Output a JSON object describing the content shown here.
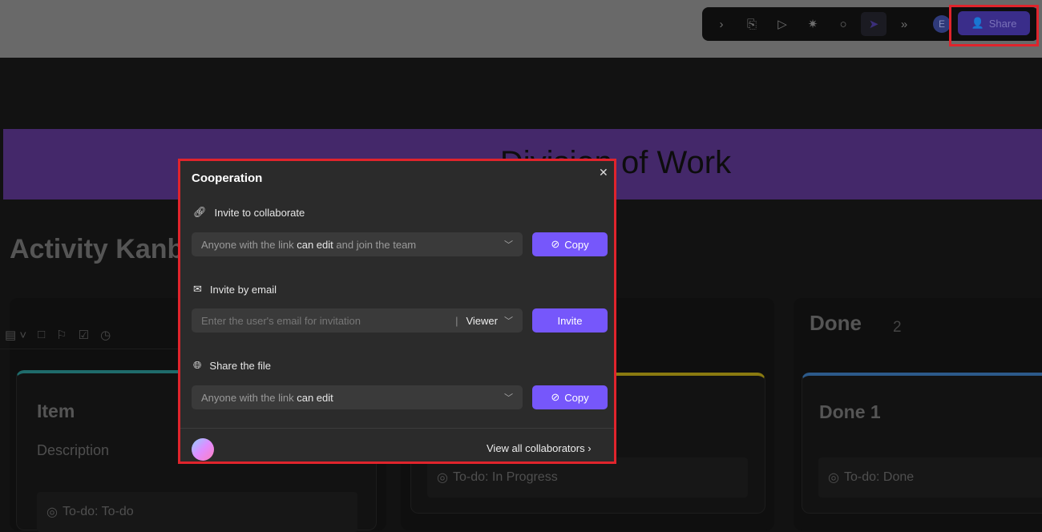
{
  "toolbar": {
    "icons": [
      "chevron-right-icon",
      "lock-file-icon",
      "play-icon",
      "party-popper-icon",
      "comment-icon",
      "cursor-icon",
      "double-chevron-down-icon"
    ],
    "user_initial": "E",
    "share_label": "Share"
  },
  "board": {
    "banner_title": "Division of Work",
    "kanban_title": "Activity Kanban",
    "columns": [
      {
        "card_title": "Item",
        "card_description": "Description",
        "todo": "To-do: To-do",
        "accent": "#1f6b6b"
      },
      {
        "todo": "To-do: In Progress",
        "accent": "#8a7a10"
      },
      {
        "header": "Done",
        "count": "2",
        "card_title": "Done 1",
        "todo": "To-do: Done",
        "accent": "#2c5a8a"
      }
    ]
  },
  "popup": {
    "title": "Cooperation",
    "invite_collab": {
      "label": "Invite to collaborate",
      "link_prefix": "Anyone with the link ",
      "link_perm": "can edit",
      "link_suffix": " and join the team",
      "copy": "Copy"
    },
    "invite_email": {
      "label": "Invite by email",
      "placeholder": "Enter the user's email for invitation",
      "role": "Viewer",
      "invite": "Invite"
    },
    "share_file": {
      "label": "Share the file",
      "link_prefix": "Anyone with the link ",
      "link_perm": "can edit",
      "copy": "Copy"
    },
    "view_all": "View all collaborators"
  },
  "colors": {
    "accent": "#7657fb",
    "highlight": "#e0242c",
    "banner": "#44286a"
  }
}
